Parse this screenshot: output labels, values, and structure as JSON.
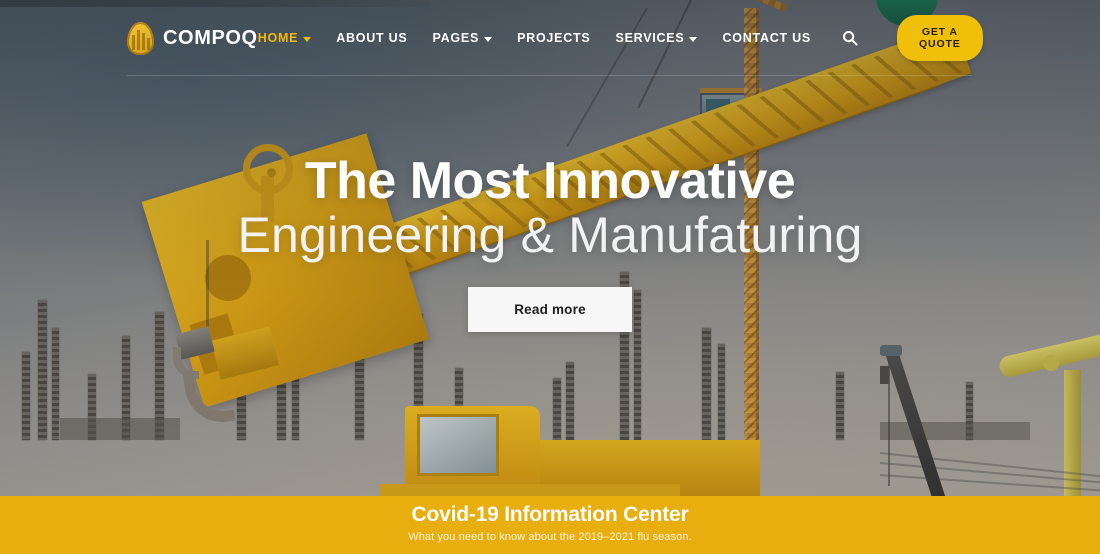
{
  "brand": {
    "name": "COMPOQ",
    "logo_icon": "building-columns-shield-icon",
    "accent": "#f0bf09"
  },
  "nav": {
    "items": [
      {
        "label": "HOME",
        "has_dropdown": true,
        "active": true
      },
      {
        "label": "ABOUT US",
        "has_dropdown": false,
        "active": false
      },
      {
        "label": "PAGES",
        "has_dropdown": true,
        "active": false
      },
      {
        "label": "PROJECTS",
        "has_dropdown": false,
        "active": false
      },
      {
        "label": "SERVICES",
        "has_dropdown": true,
        "active": false
      },
      {
        "label": "CONTACT US",
        "has_dropdown": false,
        "active": false
      }
    ],
    "search_icon": "search-icon",
    "quote_label": "GET A QUOTE"
  },
  "hero": {
    "title": "The Most Innovative",
    "subtitle": "Engineering & Manufaturing",
    "cta_label": "Read more",
    "background": "construction-site-crane-photo"
  },
  "covid_banner": {
    "title": "Covid-19 Information Center",
    "subtitle": "What you need to know about the 2019–2021 flu season.",
    "background_color": "#e8ae0e"
  }
}
